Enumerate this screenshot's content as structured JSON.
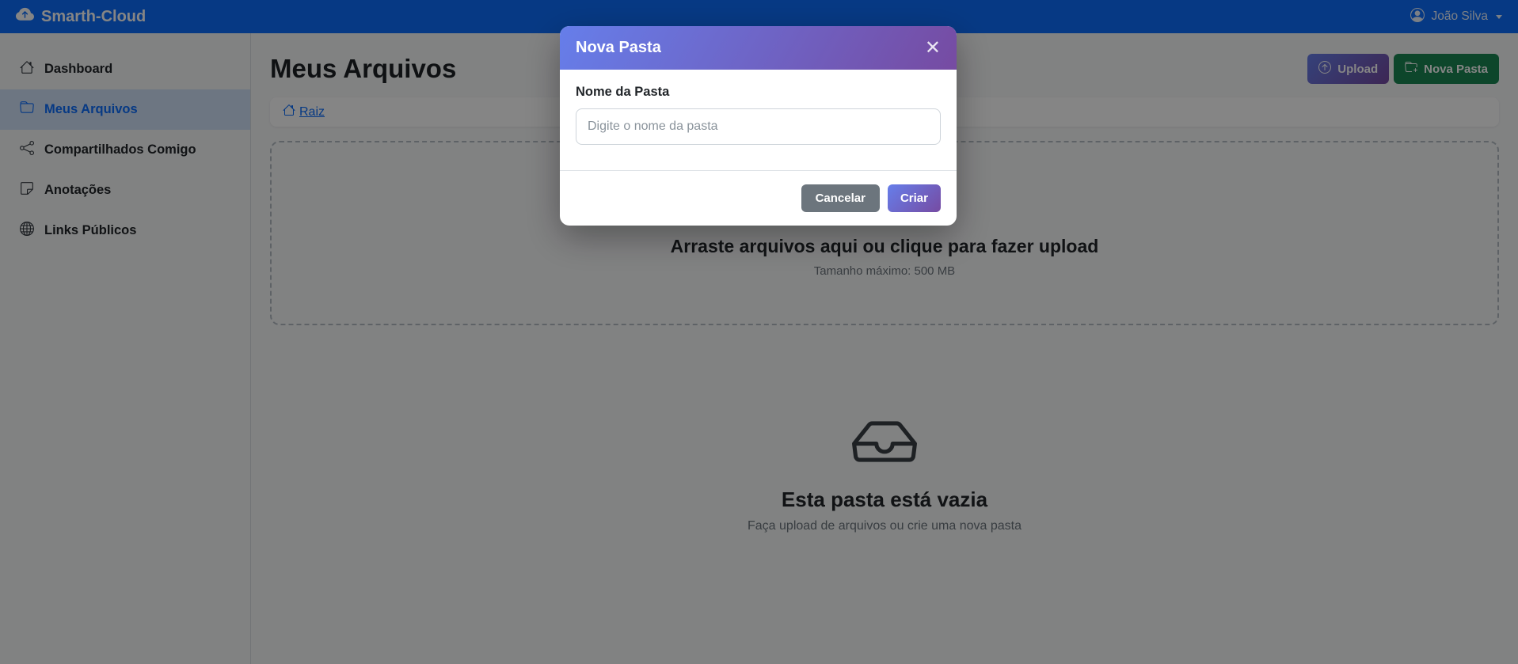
{
  "navbar": {
    "brand": "Smarth-Cloud",
    "user_name": "João Silva"
  },
  "sidebar": {
    "items": [
      {
        "icon": "house-icon",
        "label": "Dashboard",
        "active": false
      },
      {
        "icon": "folder-icon",
        "label": "Meus Arquivos",
        "active": true
      },
      {
        "icon": "share-icon",
        "label": "Compartilhados Comigo",
        "active": false
      },
      {
        "icon": "sticky-note-icon",
        "label": "Anotações",
        "active": false
      },
      {
        "icon": "globe-icon",
        "label": "Links Públicos",
        "active": false
      }
    ]
  },
  "main": {
    "title": "Meus Arquivos",
    "breadcrumb_root": "Raiz",
    "upload_button": "Upload",
    "new_folder_button": "Nova Pasta",
    "dropzone": {
      "title": "Arraste arquivos aqui ou clique para fazer upload",
      "subtitle": "Tamanho máximo: 500 MB"
    },
    "empty_state": {
      "title": "Esta pasta está vazia",
      "subtitle": "Faça upload de arquivos ou crie uma nova pasta"
    }
  },
  "modal": {
    "title": "Nova Pasta",
    "close_glyph": "✕",
    "field_label": "Nome da Pasta",
    "input_value": "",
    "input_placeholder": "Digite o nome da pasta",
    "cancel_button": "Cancelar",
    "create_button": "Criar"
  },
  "colors": {
    "navbar_blue": "#0d6efd",
    "gradient_start": "#667eea",
    "gradient_end": "#764ba2",
    "success_green": "#198754",
    "secondary_gray": "#6c757d",
    "link_blue": "#0d6efd",
    "backdrop": "rgba(0,0,0,0.48)"
  }
}
